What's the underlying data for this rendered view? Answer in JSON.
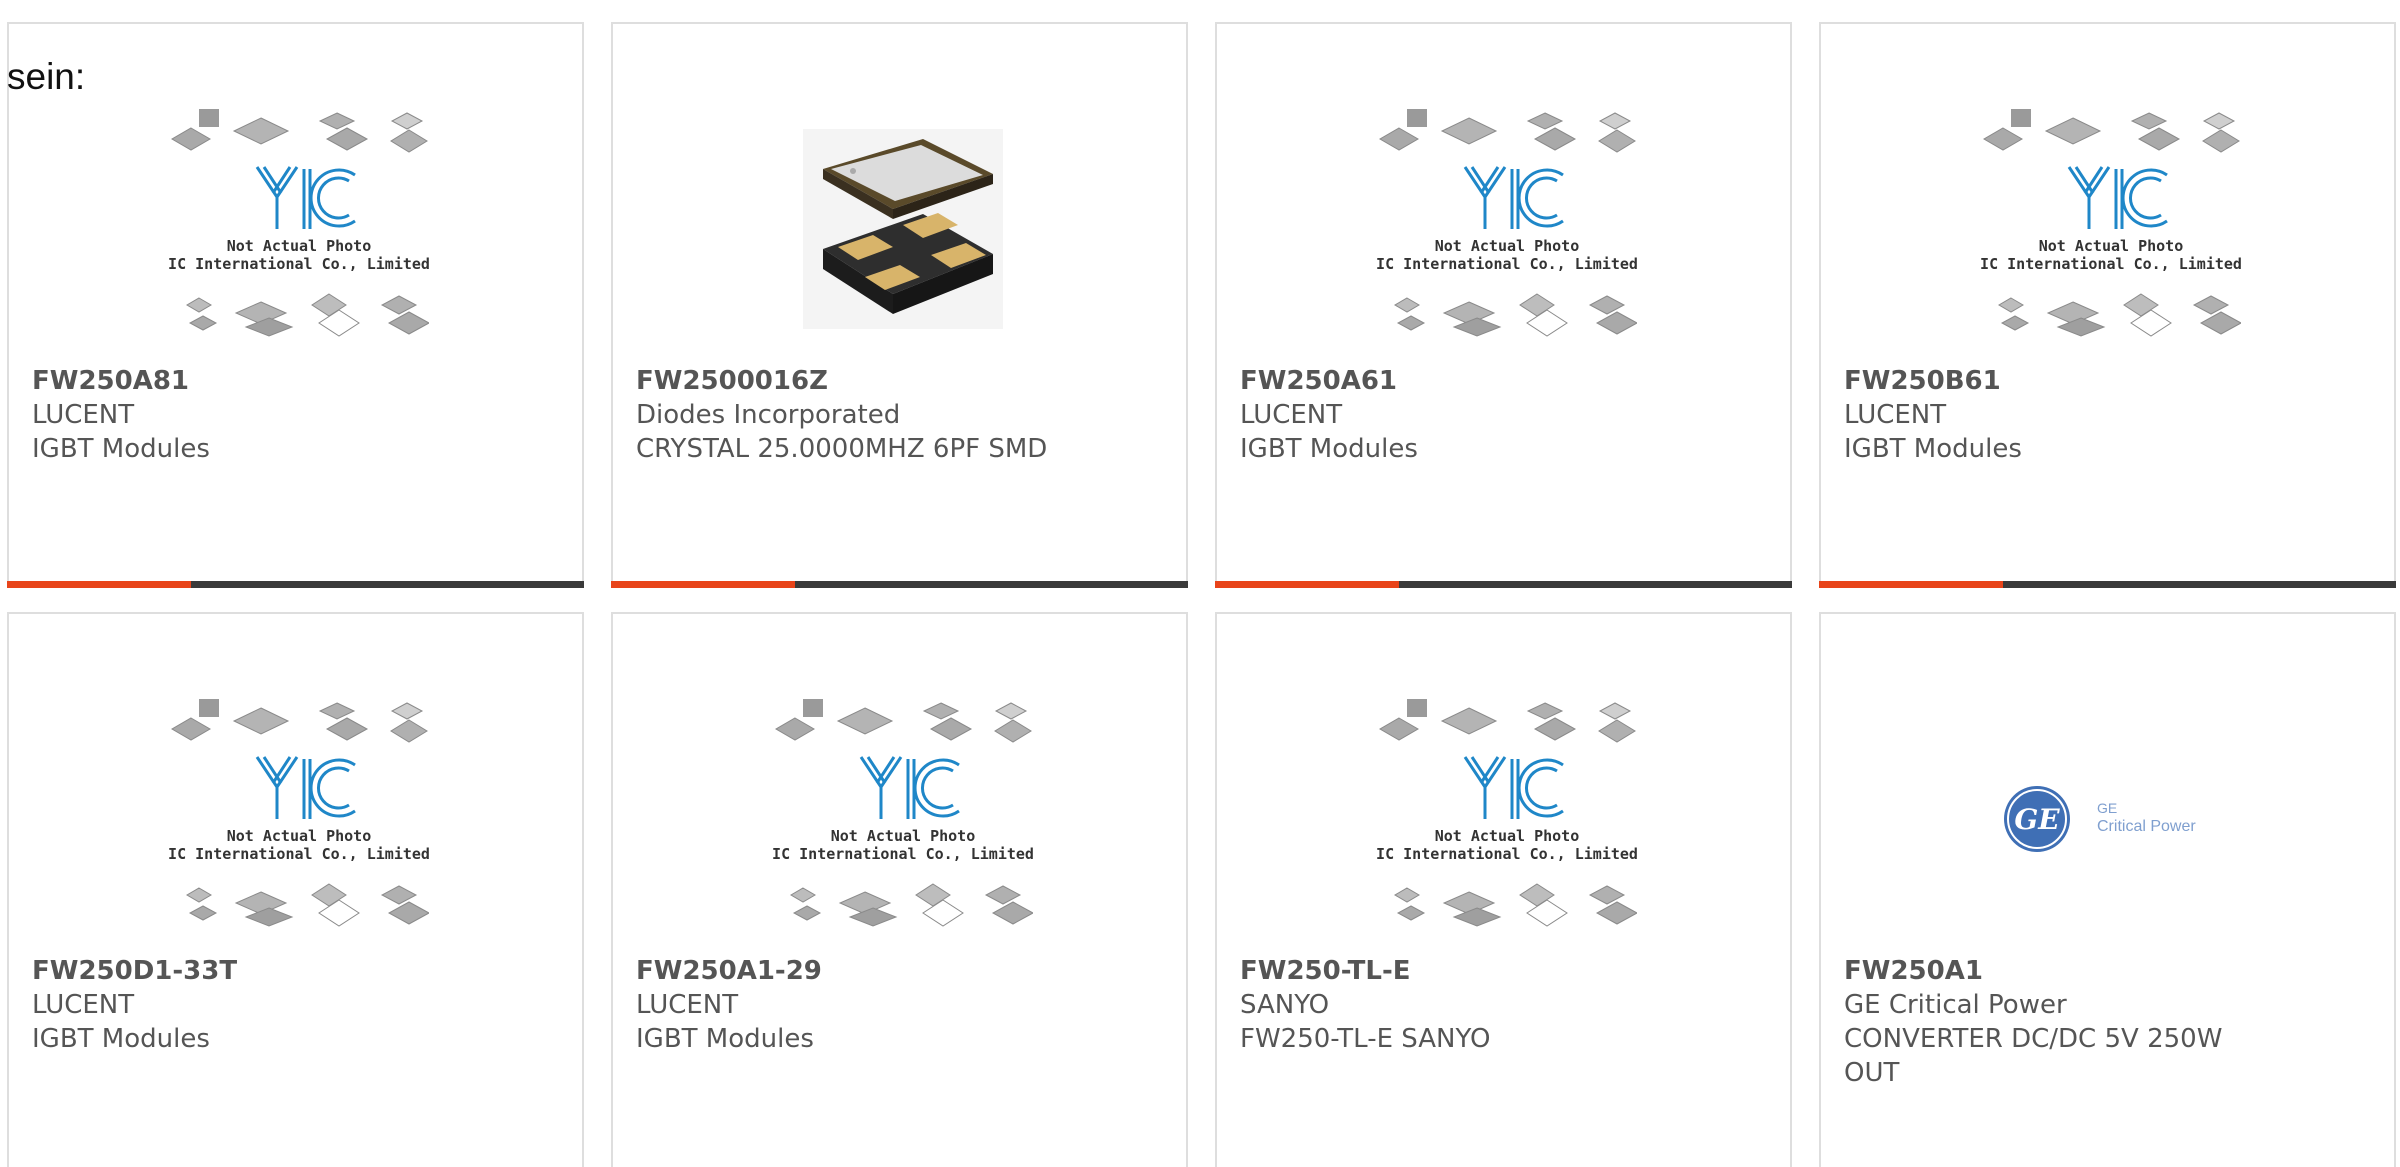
{
  "heading": "sein:",
  "colors": {
    "accent": "#e8441a",
    "bar": "#3a3a3a",
    "border": "#dedede",
    "logo_blue": "#1f87c8",
    "ge_blue": "#3f6fb5"
  },
  "placeholder": {
    "line1": "Not Actual Photo",
    "line2": "YIC International Co., Limited."
  },
  "ge_logo": {
    "line1": "GE",
    "line2": "Critical Power"
  },
  "products": [
    {
      "part": "FW250A81",
      "maker": "LUCENT",
      "desc": "IGBT Modules",
      "image": "yic-placeholder",
      "bar": true
    },
    {
      "part": "FW2500016Z",
      "maker": "Diodes Incorporated",
      "desc": "CRYSTAL 25.0000MHZ 6PF SMD",
      "image": "crystal-photo",
      "bar": true
    },
    {
      "part": "FW250A61",
      "maker": "LUCENT",
      "desc": "IGBT Modules",
      "image": "yic-placeholder",
      "bar": true
    },
    {
      "part": "FW250B61",
      "maker": "LUCENT",
      "desc": "IGBT Modules",
      "image": "yic-placeholder",
      "bar": true
    },
    {
      "part": "FW250D1-33T",
      "maker": "LUCENT",
      "desc": "IGBT Modules",
      "image": "yic-placeholder",
      "bar": false
    },
    {
      "part": "FW250A1-29",
      "maker": "LUCENT",
      "desc": "IGBT Modules",
      "image": "yic-placeholder",
      "bar": false
    },
    {
      "part": "FW250-TL-E",
      "maker": "SANYO",
      "desc": "FW250-TL-E SANYO",
      "image": "yic-placeholder",
      "bar": false
    },
    {
      "part": "FW250A1",
      "maker": "GE Critical Power",
      "desc": "CONVERTER DC/DC 5V 250W OUT",
      "image": "ge-logo",
      "bar": false
    }
  ]
}
